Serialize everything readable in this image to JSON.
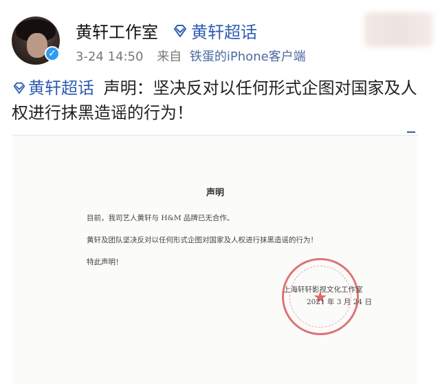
{
  "post": {
    "author": "黄轩工作室",
    "topic_link": "黄轩超话",
    "time": "3-24 14:50",
    "source_prefix": "来自",
    "source": "铁蛋的iPhone客户端",
    "tag": "黄轩超话",
    "body": "声明：坚决反对以任何形式企图对国家及人权进行抹黑造谣的行为！"
  },
  "document": {
    "title": "声明",
    "paragraph1": "目前，我司艺人黄轩与 H&M 品牌已无合作。",
    "paragraph2": "黄轩及团队坚决反对以任何形式企图对国家及人权进行抹黑造谣的行为！",
    "closing": "特此声明！",
    "signature_org": "上海轩轩影视文化工作室",
    "signature_date": "2021 年 3 月 24 日"
  },
  "colors": {
    "link": "#2f5db3",
    "stamp": "#d64646",
    "verified": "#2f9cf0"
  },
  "icons": {
    "topic": "diamond-icon",
    "verified": "verified-badge-icon"
  }
}
